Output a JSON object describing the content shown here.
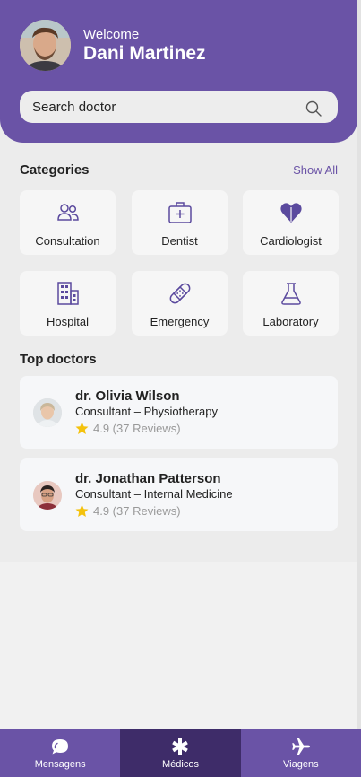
{
  "header": {
    "welcome": "Welcome",
    "user_name": "Dani Martinez"
  },
  "search": {
    "placeholder": "Search doctor"
  },
  "categories": {
    "title": "Categories",
    "show_all": "Show All",
    "items": [
      {
        "label": "Consultation",
        "icon": "people-icon"
      },
      {
        "label": "Dentist",
        "icon": "medical-kit-icon"
      },
      {
        "label": "Cardiologist",
        "icon": "heart-icon"
      },
      {
        "label": "Hospital",
        "icon": "hospital-icon"
      },
      {
        "label": "Emergency",
        "icon": "bandage-icon"
      },
      {
        "label": "Laboratory",
        "icon": "flask-icon"
      }
    ]
  },
  "top_doctors": {
    "title": "Top doctors",
    "items": [
      {
        "name": "dr. Olivia Wilson",
        "specialty": "Consultant – Physiotherapy",
        "rating": "4.9 (37 Reviews)"
      },
      {
        "name": "dr. Jonathan Patterson",
        "specialty": "Consultant – Internal Medicine",
        "rating": "4.9 (37 Reviews)"
      }
    ]
  },
  "bottom_nav": {
    "items": [
      {
        "label": "Mensagens",
        "icon": "chat-icon",
        "active": false
      },
      {
        "label": "Médicos",
        "icon": "asterisk-icon",
        "active": true
      },
      {
        "label": "Viagens",
        "icon": "airplane-icon",
        "active": false
      }
    ]
  },
  "colors": {
    "brand": "#6a53a6",
    "nav_active": "#3e2c69",
    "star": "#f4c20d"
  }
}
